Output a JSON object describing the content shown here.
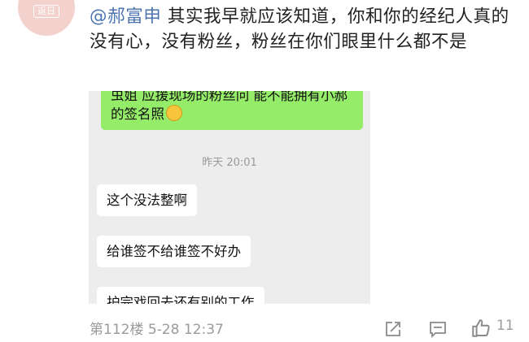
{
  "avatar": {
    "mark_text": "返日"
  },
  "comment": {
    "mention": "@郝富申",
    "body": " 其实我早就应该知道，你和你的经纪人真的没有心，没有粉丝，粉丝在你们眼里什么都不是"
  },
  "chat": {
    "top_bubble": {
      "text": "虫姐 应援现场的粉丝问 能不能拥有小郝的签名照"
    },
    "timestamp": "昨天 20:01",
    "messages": [
      {
        "text": "这个没法整啊"
      },
      {
        "text": "给谁签不给谁签不好办"
      },
      {
        "text": "护完戏回去还有别的工作"
      }
    ]
  },
  "footer": {
    "floor": "第112楼",
    "date": "5-28 12:37",
    "like_count": "11"
  },
  "icons": {
    "share": "share-icon",
    "comment": "comment-icon",
    "like": "thumbs-up-icon",
    "top_bubble_emoji": "facepalm-emoji-icon"
  },
  "colors": {
    "mention": "#4a73b0",
    "green_bubble": "#95ec69",
    "chat_bg": "#ededed",
    "meta_text": "#9b9b9b"
  }
}
